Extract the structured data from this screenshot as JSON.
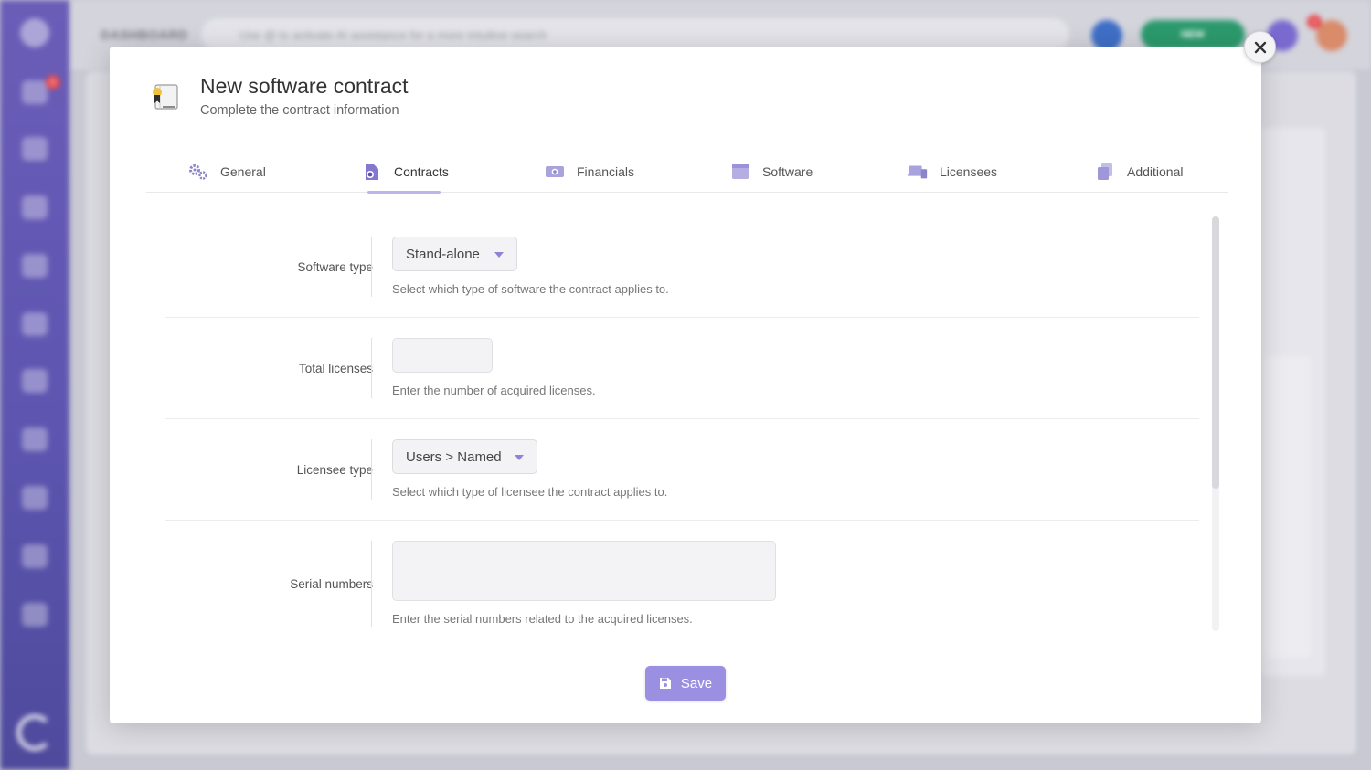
{
  "background": {
    "title": "DASHBOARD",
    "search_placeholder": "Use @ to activate AI assistance for a more intuitive search",
    "new_button": "NEW",
    "sidebar_badge": "5",
    "notification_badge": "2"
  },
  "modal": {
    "title": "New software contract",
    "subtitle": "Complete the contract information",
    "close_icon": "close-icon",
    "header_icon": "certificate-icon"
  },
  "tabs": [
    {
      "label": "General",
      "icon": "gears-icon",
      "active": false
    },
    {
      "label": "Contracts",
      "icon": "file-contract-icon",
      "active": true
    },
    {
      "label": "Financials",
      "icon": "money-bill-icon",
      "active": false
    },
    {
      "label": "Software",
      "icon": "window-icon",
      "active": false
    },
    {
      "label": "Licensees",
      "icon": "devices-icon",
      "active": false
    },
    {
      "label": "Additional",
      "icon": "copy-icon",
      "active": false
    }
  ],
  "form": {
    "software_type": {
      "label": "Software type",
      "value": "Stand-alone",
      "help": "Select which type of software the contract applies to."
    },
    "total_licenses": {
      "label": "Total licenses",
      "value": "",
      "help": "Enter the number of acquired licenses."
    },
    "licensee_type": {
      "label": "Licensee type",
      "value": "Users > Named",
      "help": "Select which type of licensee the contract applies to."
    },
    "serial_numbers": {
      "label": "Serial numbers",
      "value": "",
      "help": "Enter the serial numbers related to the acquired licenses."
    }
  },
  "save_label": "Save",
  "colors": {
    "accent": "#9b8fe2",
    "sidebar": "#5d55b0",
    "new_button": "#2c9a6d"
  }
}
